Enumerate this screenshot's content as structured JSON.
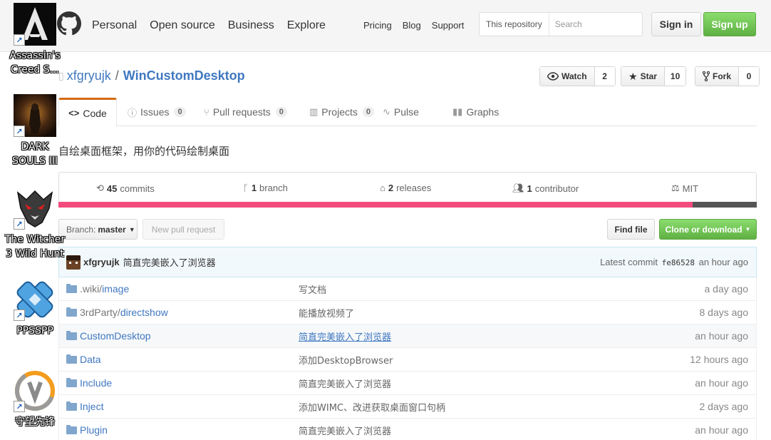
{
  "header": {
    "nav_main": [
      "Personal",
      "Open source",
      "Business",
      "Explore"
    ],
    "nav_sub": [
      "Pricing",
      "Blog",
      "Support"
    ],
    "search_scope": "This repository",
    "search_placeholder": "Search",
    "signin_label": "Sign in",
    "signup_label": "Sign up",
    "colors": {
      "signup": "#60b044"
    }
  },
  "repo": {
    "owner": "xfgryujk",
    "name": "WinCustomDesktop",
    "separator": "/",
    "watch_label": "Watch",
    "watch_count": "2",
    "star_label": "Star",
    "star_count": "10",
    "fork_label": "Fork",
    "fork_count": "0",
    "description": "自绘桌面框架，用你的代码绘制桌面"
  },
  "tabs": [
    {
      "label": "Code",
      "icon": "code-icon",
      "selected": true
    },
    {
      "label": "Issues",
      "icon": "issue-icon",
      "count": "0"
    },
    {
      "label": "Pull requests",
      "icon": "pull-request-icon",
      "count": "0"
    },
    {
      "label": "Projects",
      "icon": "project-icon",
      "count": "0"
    },
    {
      "label": "Pulse",
      "icon": "pulse-icon"
    },
    {
      "label": "Graphs",
      "icon": "graph-icon"
    }
  ],
  "summary": {
    "commits_num": "45",
    "commits_label": "commits",
    "branch_num": "1",
    "branch_label": "branch",
    "releases_num": "2",
    "releases_label": "releases",
    "contrib_num": "1",
    "contrib_label": "contributor",
    "license": "MIT"
  },
  "file_nav": {
    "branch_prefix": "Branch:",
    "branch_name": "master",
    "new_pr_label": "New pull request",
    "find_file_label": "Find file",
    "clone_label": "Clone or download"
  },
  "commit": {
    "author": "xfgryujk",
    "message": "简直完美嵌入了浏览器",
    "latest_label": "Latest commit",
    "sha": "fe86528",
    "age": "an hour ago"
  },
  "files": [
    {
      "dim": ".wiki/",
      "name": "image",
      "message": "写文档",
      "age": "a day ago"
    },
    {
      "dim": "3rdParty/",
      "name": "directshow",
      "message": "能播放视频了",
      "age": "8 days ago"
    },
    {
      "dim": "",
      "name": "CustomDesktop",
      "message": "简直完美嵌入了浏览器",
      "age": "an hour ago",
      "highlight": true
    },
    {
      "dim": "",
      "name": "Data",
      "message": "添加DesktopBrowser",
      "age": "12 hours ago"
    },
    {
      "dim": "",
      "name": "Include",
      "message": "简直完美嵌入了浏览器",
      "age": "an hour ago"
    },
    {
      "dim": "",
      "name": "Inject",
      "message": "添加WIMC、改进获取桌面窗口句柄",
      "age": "2 days ago"
    },
    {
      "dim": "",
      "name": "Plugin",
      "message": "简直完美嵌入了浏览器",
      "age": "an hour ago"
    }
  ],
  "desktop_icons": [
    {
      "label": "Assassin's\nCreed S...",
      "icon": "assassins-creed-icon"
    },
    {
      "label": "DARK\nSOULS III",
      "icon": "dark-souls-icon"
    },
    {
      "label": "The Witcher\n3 Wild Hunt",
      "icon": "witcher-icon"
    },
    {
      "label": "PPSSPP",
      "icon": "ppsspp-icon"
    },
    {
      "label": "守望先锋",
      "icon": "overwatch-icon"
    }
  ]
}
